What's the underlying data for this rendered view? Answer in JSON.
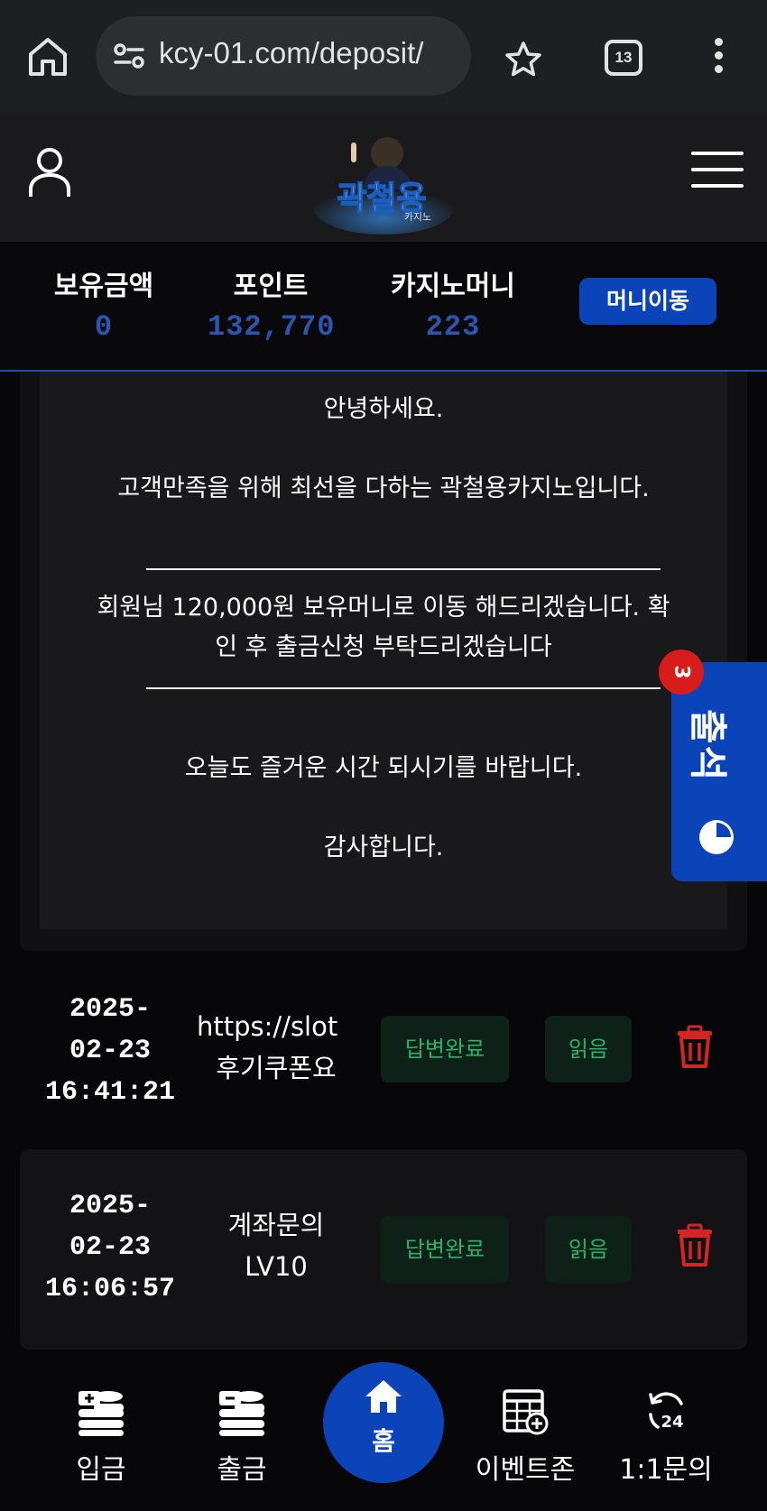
{
  "browser": {
    "url": "kcy-01.com/deposit/",
    "tab_count": "13"
  },
  "header": {
    "logo_text": "곽철용",
    "logo_subtext": "카지노"
  },
  "balance": {
    "holding_label": "보유금액",
    "holding_value": "0",
    "point_label": "포인트",
    "point_value": "132,770",
    "casino_label": "카지노머니",
    "casino_value": "223",
    "move_button": "머니이동"
  },
  "message": {
    "greeting": "안녕하세요.",
    "intro": "고객만족을 위해 최선을 다하는 곽철용카지노입니다.",
    "body_line1": "회원님 120,000원 보유머니로 이동 해드리겠습니다. 확",
    "body_line2": "인 후 출금신청 부탁드리겠습니다",
    "closing": "오늘도 즐거운 시간 되시기를 바랍니다.",
    "thanks": "감사합니다."
  },
  "side_tab": {
    "label": "출석",
    "badge": "3"
  },
  "inquiries": [
    {
      "date": "2025-",
      "date2": "02-23",
      "time": "16:41:21",
      "title1": "https://slot",
      "title2": "후기쿠폰요",
      "status": "답변완료",
      "read": "읽음"
    },
    {
      "date": "2025-",
      "date2": "02-23",
      "time": "16:06:57",
      "title1": "계좌문의",
      "title2": "LV10",
      "status": "답변완료",
      "read": "읽음"
    }
  ],
  "bottom_nav": {
    "deposit": "입금",
    "withdraw": "출금",
    "home": "홈",
    "event": "이벤트존",
    "inquiry": "1:1문의"
  },
  "colors": {
    "accent_blue": "#0b43b8",
    "value_blue": "#2c55b0",
    "status_green": "#26b36a",
    "trash_red": "#d42525"
  }
}
